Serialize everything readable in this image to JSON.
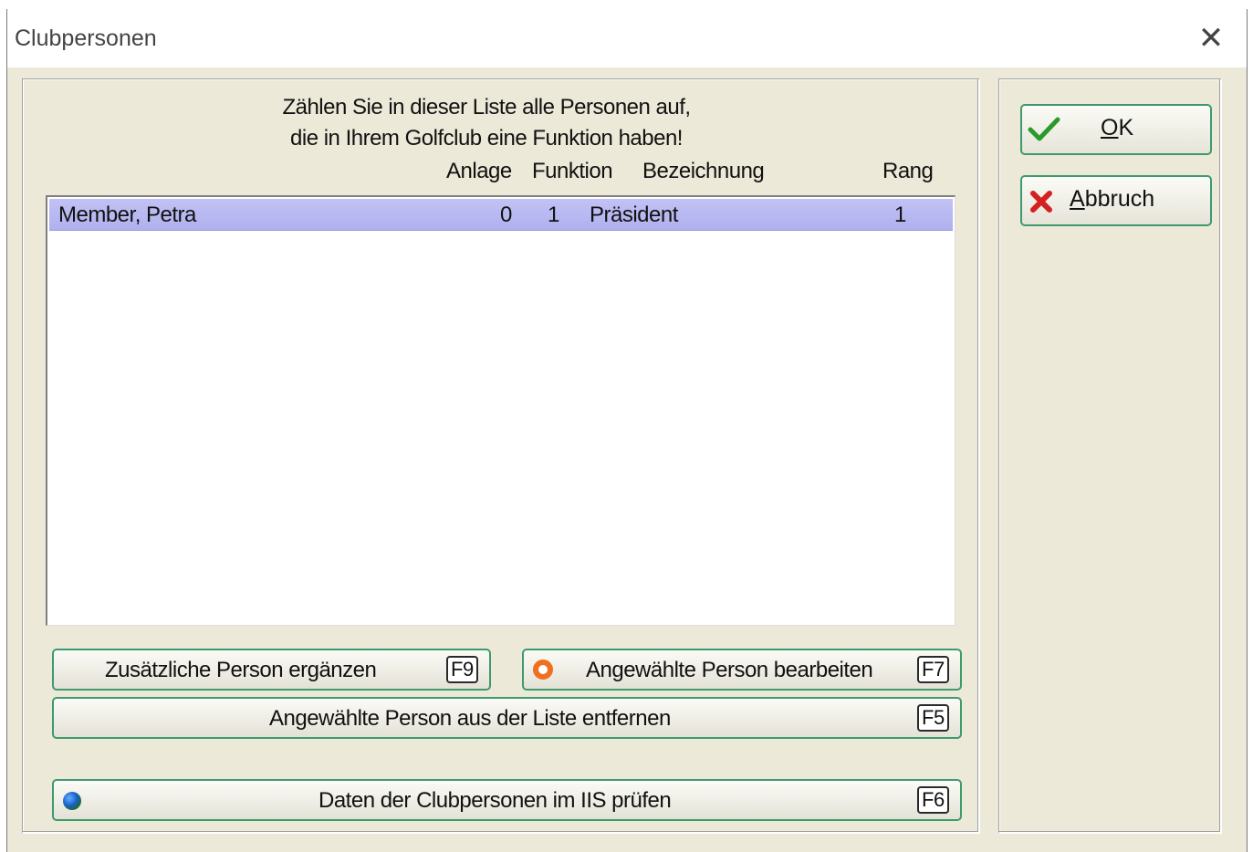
{
  "window": {
    "title": "Clubpersonen",
    "close_symbol": "✕"
  },
  "instructions": {
    "line1": "Zählen Sie in dieser Liste alle Personen auf,",
    "line2": "die in Ihrem Golfclub eine Funktion haben!"
  },
  "columns": {
    "anlage": "Anlage",
    "funktion": "Funktion",
    "bezeichnung": "Bezeichnung",
    "rang": "Rang"
  },
  "rows": [
    {
      "name": "Member, Petra",
      "anlage": "0",
      "funktion": "1",
      "bezeichnung": "Präsident",
      "rang": "1",
      "selected": true
    }
  ],
  "buttons": {
    "add": {
      "label": "Zusätzliche Person ergänzen",
      "key": "F9"
    },
    "edit": {
      "label": "Angewählte Person bearbeiten",
      "key": "F7",
      "icon": "ring-icon"
    },
    "remove": {
      "label": "Angewählte Person aus der Liste entfernen",
      "key": "F5"
    },
    "check": {
      "label": "Daten der Clubpersonen im IIS prüfen",
      "key": "F6",
      "icon": "globe-icon"
    }
  },
  "side": {
    "ok": {
      "mnemonic": "O",
      "rest": "K",
      "icon": "checkmark-icon",
      "color": "#2a9a2a"
    },
    "cancel": {
      "mnemonic": "A",
      "rest": "bbruch",
      "icon": "x-icon",
      "color": "#d42020"
    }
  },
  "colors": {
    "selection": "#b8b8f2",
    "button_border": "#3e9a6e",
    "dialog_bg": "#ece9d8"
  }
}
